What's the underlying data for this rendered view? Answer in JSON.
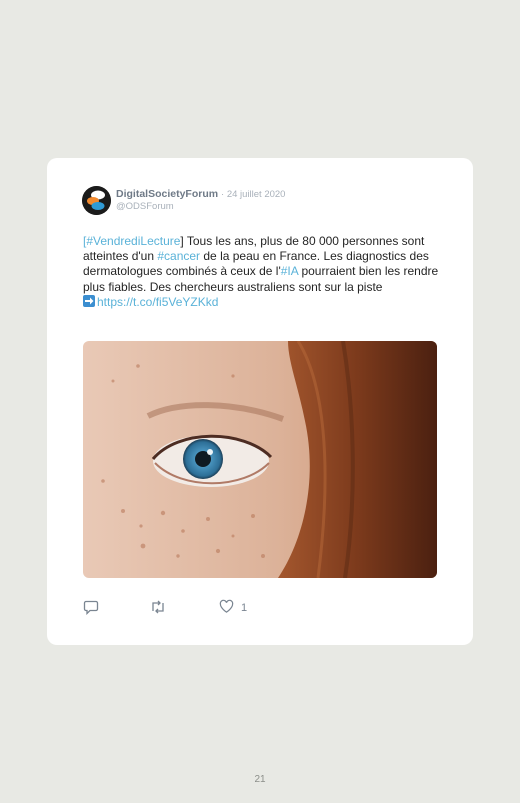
{
  "tweet": {
    "author_name": "DigitalSocietyForum",
    "date": "· 24 juillet 2020",
    "handle": "@ODSForum",
    "text": {
      "open_bracket": "[",
      "hashtag_vendredi": "#VendrediLecture",
      "part1": "] Tous les ans, plus de 80 000 personnes sont atteintes d'un ",
      "hashtag_cancer": "#cancer",
      "part2": " de la peau en France. Les diagnostics des dermatologues combinés à ceux de l'",
      "hashtag_ia": "#IA",
      "part3": " pourraient bien les rendre plus fiables. Des chercheurs australiens sont sur la piste",
      "link": "https://t.co/fi5VeYZKkd"
    },
    "like_count": "1"
  },
  "page_number": "21",
  "icons": {
    "reply": "reply-icon",
    "retweet": "retweet-icon",
    "like": "heart-icon",
    "arrow": "right-arrow-icon"
  },
  "colors": {
    "accent": "#5ab2d8",
    "background": "#e8e9e4",
    "card": "#ffffff"
  }
}
